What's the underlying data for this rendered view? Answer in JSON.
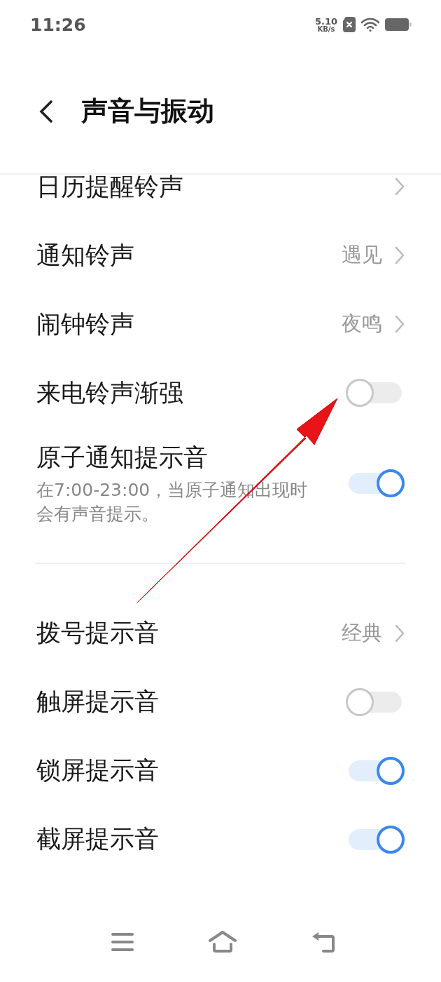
{
  "status_bar": {
    "time": "11:26",
    "speed_value": "5.10",
    "speed_unit": "KB/s"
  },
  "header": {
    "title": "声音与振动"
  },
  "sections": [
    {
      "items": [
        {
          "kind": "link",
          "label": "日历提醒铃声"
        },
        {
          "kind": "link",
          "label": "通知铃声",
          "value": "遇见"
        },
        {
          "kind": "link",
          "label": "闹钟铃声",
          "value": "夜鸣"
        },
        {
          "kind": "switch",
          "label": "来电铃声渐强",
          "on": false
        },
        {
          "kind": "switch",
          "label": "原子通知提示音",
          "description": "在7:00-23:00，当原子通知出现时会有声音提示。",
          "on": true
        }
      ]
    },
    {
      "items": [
        {
          "kind": "link",
          "label": "拨号提示音",
          "value": "经典"
        },
        {
          "kind": "switch",
          "label": "触屏提示音",
          "on": false
        },
        {
          "kind": "switch",
          "label": "锁屏提示音",
          "on": true
        },
        {
          "kind": "switch",
          "label": "截屏提示音",
          "on": true
        }
      ]
    }
  ]
}
